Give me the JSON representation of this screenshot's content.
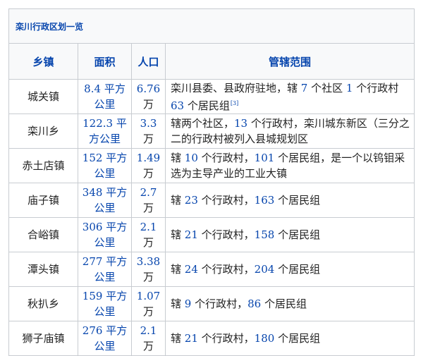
{
  "caption": "栾川行政区划一览",
  "headers": {
    "township": "乡镇",
    "area": "面积",
    "population": "人口",
    "jurisdiction": "管辖范围"
  },
  "rows": [
    {
      "name": "城关镇",
      "area_num": "8.4",
      "area_unit": "平方公里",
      "pop_num": "6.76",
      "pop_unit": "万",
      "desc": [
        {
          "t": "栾川县委、县政府驻地，辖 "
        },
        {
          "t": "7",
          "n": 1
        },
        {
          "t": " 个社区 "
        },
        {
          "t": "1",
          "n": 1
        },
        {
          "t": " 个行政村 "
        },
        {
          "t": "63",
          "n": 1
        },
        {
          "t": " 个居民组"
        }
      ],
      "ref": "[3]"
    },
    {
      "name": "栾川乡",
      "area_num": "122.3",
      "area_unit": "平方公里",
      "pop_num": "3.3",
      "pop_unit": "万",
      "desc": [
        {
          "t": "辖两个社区，"
        },
        {
          "t": "13",
          "n": 1
        },
        {
          "t": " 个行政村，栾川城东新区（三分之二的行政村被列入县城规划区"
        }
      ]
    },
    {
      "name": "赤土店镇",
      "area_num": "152",
      "area_unit": "平方公里",
      "pop_num": "1.49",
      "pop_unit": "万",
      "desc": [
        {
          "t": "辖 "
        },
        {
          "t": "10",
          "n": 1
        },
        {
          "t": " 个行政村，"
        },
        {
          "t": "101",
          "n": 1
        },
        {
          "t": " 个居民组，是一个以钨钼采选为主导产业的工业大镇"
        }
      ]
    },
    {
      "name": "庙子镇",
      "area_num": "348",
      "area_unit": "平方公里",
      "pop_num": "2.7",
      "pop_unit": "万",
      "desc": [
        {
          "t": "辖 "
        },
        {
          "t": "23",
          "n": 1
        },
        {
          "t": " 个行政村，"
        },
        {
          "t": "163",
          "n": 1
        },
        {
          "t": " 个居民组"
        }
      ]
    },
    {
      "name": "合峪镇",
      "area_num": "306",
      "area_unit": "平方公里",
      "pop_num": "2.1",
      "pop_unit": "万",
      "desc": [
        {
          "t": "辖 "
        },
        {
          "t": "21",
          "n": 1
        },
        {
          "t": " 个行政村，"
        },
        {
          "t": "158",
          "n": 1
        },
        {
          "t": " 个居民组"
        }
      ]
    },
    {
      "name": "潭头镇",
      "area_num": "277",
      "area_unit": "平方公里",
      "pop_num": "3.38",
      "pop_unit": "万",
      "desc": [
        {
          "t": "辖 "
        },
        {
          "t": "24",
          "n": 1
        },
        {
          "t": " 个行政村，"
        },
        {
          "t": "204",
          "n": 1
        },
        {
          "t": " 个居民组"
        }
      ]
    },
    {
      "name": "秋扒乡",
      "area_num": "159",
      "area_unit": "平方公里",
      "pop_num": "1.07",
      "pop_unit": "万",
      "desc": [
        {
          "t": "辖 "
        },
        {
          "t": "9",
          "n": 1
        },
        {
          "t": " 个行政村，"
        },
        {
          "t": "86",
          "n": 1
        },
        {
          "t": " 个居民组"
        }
      ]
    },
    {
      "name": "狮子庙镇",
      "area_num": "276",
      "area_unit": "平方公里",
      "pop_num": "2.1",
      "pop_unit": "万",
      "desc": [
        {
          "t": "辖 "
        },
        {
          "t": "21",
          "n": 1
        },
        {
          "t": " 个行政村，"
        },
        {
          "t": "180",
          "n": 1
        },
        {
          "t": " 个居民组"
        }
      ]
    }
  ]
}
